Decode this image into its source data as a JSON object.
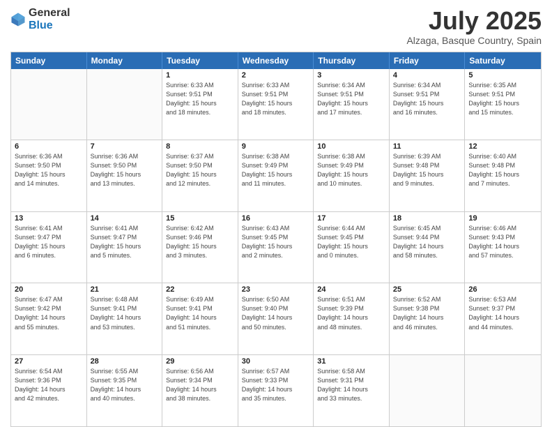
{
  "header": {
    "logo_general": "General",
    "logo_blue": "Blue",
    "title": "July 2025",
    "subtitle": "Alzaga, Basque Country, Spain"
  },
  "days": [
    "Sunday",
    "Monday",
    "Tuesday",
    "Wednesday",
    "Thursday",
    "Friday",
    "Saturday"
  ],
  "weeks": [
    [
      {
        "day": "",
        "content": ""
      },
      {
        "day": "",
        "content": ""
      },
      {
        "day": "1",
        "content": "Sunrise: 6:33 AM\nSunset: 9:51 PM\nDaylight: 15 hours\nand 18 minutes."
      },
      {
        "day": "2",
        "content": "Sunrise: 6:33 AM\nSunset: 9:51 PM\nDaylight: 15 hours\nand 18 minutes."
      },
      {
        "day": "3",
        "content": "Sunrise: 6:34 AM\nSunset: 9:51 PM\nDaylight: 15 hours\nand 17 minutes."
      },
      {
        "day": "4",
        "content": "Sunrise: 6:34 AM\nSunset: 9:51 PM\nDaylight: 15 hours\nand 16 minutes."
      },
      {
        "day": "5",
        "content": "Sunrise: 6:35 AM\nSunset: 9:51 PM\nDaylight: 15 hours\nand 15 minutes."
      }
    ],
    [
      {
        "day": "6",
        "content": "Sunrise: 6:36 AM\nSunset: 9:50 PM\nDaylight: 15 hours\nand 14 minutes."
      },
      {
        "day": "7",
        "content": "Sunrise: 6:36 AM\nSunset: 9:50 PM\nDaylight: 15 hours\nand 13 minutes."
      },
      {
        "day": "8",
        "content": "Sunrise: 6:37 AM\nSunset: 9:50 PM\nDaylight: 15 hours\nand 12 minutes."
      },
      {
        "day": "9",
        "content": "Sunrise: 6:38 AM\nSunset: 9:49 PM\nDaylight: 15 hours\nand 11 minutes."
      },
      {
        "day": "10",
        "content": "Sunrise: 6:38 AM\nSunset: 9:49 PM\nDaylight: 15 hours\nand 10 minutes."
      },
      {
        "day": "11",
        "content": "Sunrise: 6:39 AM\nSunset: 9:48 PM\nDaylight: 15 hours\nand 9 minutes."
      },
      {
        "day": "12",
        "content": "Sunrise: 6:40 AM\nSunset: 9:48 PM\nDaylight: 15 hours\nand 7 minutes."
      }
    ],
    [
      {
        "day": "13",
        "content": "Sunrise: 6:41 AM\nSunset: 9:47 PM\nDaylight: 15 hours\nand 6 minutes."
      },
      {
        "day": "14",
        "content": "Sunrise: 6:41 AM\nSunset: 9:47 PM\nDaylight: 15 hours\nand 5 minutes."
      },
      {
        "day": "15",
        "content": "Sunrise: 6:42 AM\nSunset: 9:46 PM\nDaylight: 15 hours\nand 3 minutes."
      },
      {
        "day": "16",
        "content": "Sunrise: 6:43 AM\nSunset: 9:45 PM\nDaylight: 15 hours\nand 2 minutes."
      },
      {
        "day": "17",
        "content": "Sunrise: 6:44 AM\nSunset: 9:45 PM\nDaylight: 15 hours\nand 0 minutes."
      },
      {
        "day": "18",
        "content": "Sunrise: 6:45 AM\nSunset: 9:44 PM\nDaylight: 14 hours\nand 58 minutes."
      },
      {
        "day": "19",
        "content": "Sunrise: 6:46 AM\nSunset: 9:43 PM\nDaylight: 14 hours\nand 57 minutes."
      }
    ],
    [
      {
        "day": "20",
        "content": "Sunrise: 6:47 AM\nSunset: 9:42 PM\nDaylight: 14 hours\nand 55 minutes."
      },
      {
        "day": "21",
        "content": "Sunrise: 6:48 AM\nSunset: 9:41 PM\nDaylight: 14 hours\nand 53 minutes."
      },
      {
        "day": "22",
        "content": "Sunrise: 6:49 AM\nSunset: 9:41 PM\nDaylight: 14 hours\nand 51 minutes."
      },
      {
        "day": "23",
        "content": "Sunrise: 6:50 AM\nSunset: 9:40 PM\nDaylight: 14 hours\nand 50 minutes."
      },
      {
        "day": "24",
        "content": "Sunrise: 6:51 AM\nSunset: 9:39 PM\nDaylight: 14 hours\nand 48 minutes."
      },
      {
        "day": "25",
        "content": "Sunrise: 6:52 AM\nSunset: 9:38 PM\nDaylight: 14 hours\nand 46 minutes."
      },
      {
        "day": "26",
        "content": "Sunrise: 6:53 AM\nSunset: 9:37 PM\nDaylight: 14 hours\nand 44 minutes."
      }
    ],
    [
      {
        "day": "27",
        "content": "Sunrise: 6:54 AM\nSunset: 9:36 PM\nDaylight: 14 hours\nand 42 minutes."
      },
      {
        "day": "28",
        "content": "Sunrise: 6:55 AM\nSunset: 9:35 PM\nDaylight: 14 hours\nand 40 minutes."
      },
      {
        "day": "29",
        "content": "Sunrise: 6:56 AM\nSunset: 9:34 PM\nDaylight: 14 hours\nand 38 minutes."
      },
      {
        "day": "30",
        "content": "Sunrise: 6:57 AM\nSunset: 9:33 PM\nDaylight: 14 hours\nand 35 minutes."
      },
      {
        "day": "31",
        "content": "Sunrise: 6:58 AM\nSunset: 9:31 PM\nDaylight: 14 hours\nand 33 minutes."
      },
      {
        "day": "",
        "content": ""
      },
      {
        "day": "",
        "content": ""
      }
    ]
  ]
}
